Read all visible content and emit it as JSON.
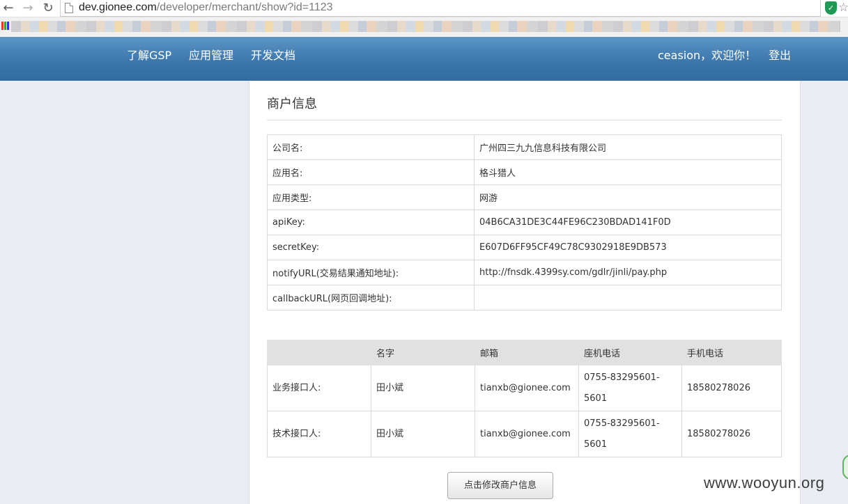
{
  "browser": {
    "back_icon": "←",
    "forward_icon": "→",
    "reload_icon": "↻",
    "url_host": "dev.gionee.com",
    "url_path": "/developer/merchant/show?id=1123",
    "shield_icon": "✓",
    "star_icon": "☆"
  },
  "header": {
    "nav": [
      "了解GSP",
      "应用管理",
      "开发文档"
    ],
    "welcome": "ceasion，欢迎你！",
    "logout": "登出",
    "bg_color": "#3a74a9"
  },
  "panel": {
    "title": "商户信息",
    "info_rows": [
      {
        "label": "公司名:",
        "value": "广州四三九九信息科技有限公司"
      },
      {
        "label": "应用名:",
        "value": "格斗猎人"
      },
      {
        "label": "应用类型:",
        "value": "网游"
      },
      {
        "label": "apiKey:",
        "value": "04B6CA31DE3C44FE96C230BDAD141F0D"
      },
      {
        "label": "secretKey:",
        "value": "E607D6FF95CF49C78C9302918E9DB573"
      },
      {
        "label": "notifyURL(交易结果通知地址):",
        "value": "http://fnsdk.4399sy.com/gdlr/jinli/pay.php"
      },
      {
        "label": "callbackURL(网页回调地址):",
        "value": ""
      }
    ],
    "contact_headers": [
      "",
      "名字",
      "邮箱",
      "座机电话",
      "手机电话"
    ],
    "contact_rows": [
      {
        "role": "业务接口人:",
        "name": "田小斌",
        "email": "tianxb@gionee.com",
        "phone_line1": "0755-83295601-",
        "phone_line2": "5601",
        "mobile": "18580278026"
      },
      {
        "role": "技术接口人:",
        "name": "田小斌",
        "email": "tianxb@gionee.com",
        "phone_line1": "0755-83295601-",
        "phone_line2": "5601",
        "mobile": "18580278026"
      }
    ],
    "edit_button": "点击修改商户信息"
  },
  "watermark": "www.wooyun.org"
}
